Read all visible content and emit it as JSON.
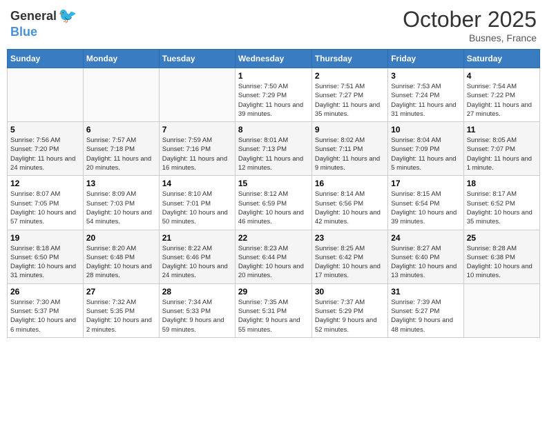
{
  "header": {
    "logo_general": "General",
    "logo_blue": "Blue",
    "month_title": "October 2025",
    "location": "Busnes, France"
  },
  "days_of_week": [
    "Sunday",
    "Monday",
    "Tuesday",
    "Wednesday",
    "Thursday",
    "Friday",
    "Saturday"
  ],
  "weeks": [
    [
      {
        "day": "",
        "info": ""
      },
      {
        "day": "",
        "info": ""
      },
      {
        "day": "",
        "info": ""
      },
      {
        "day": "1",
        "info": "Sunrise: 7:50 AM\nSunset: 7:29 PM\nDaylight: 11 hours and 39 minutes."
      },
      {
        "day": "2",
        "info": "Sunrise: 7:51 AM\nSunset: 7:27 PM\nDaylight: 11 hours and 35 minutes."
      },
      {
        "day": "3",
        "info": "Sunrise: 7:53 AM\nSunset: 7:24 PM\nDaylight: 11 hours and 31 minutes."
      },
      {
        "day": "4",
        "info": "Sunrise: 7:54 AM\nSunset: 7:22 PM\nDaylight: 11 hours and 27 minutes."
      }
    ],
    [
      {
        "day": "5",
        "info": "Sunrise: 7:56 AM\nSunset: 7:20 PM\nDaylight: 11 hours and 24 minutes."
      },
      {
        "day": "6",
        "info": "Sunrise: 7:57 AM\nSunset: 7:18 PM\nDaylight: 11 hours and 20 minutes."
      },
      {
        "day": "7",
        "info": "Sunrise: 7:59 AM\nSunset: 7:16 PM\nDaylight: 11 hours and 16 minutes."
      },
      {
        "day": "8",
        "info": "Sunrise: 8:01 AM\nSunset: 7:13 PM\nDaylight: 11 hours and 12 minutes."
      },
      {
        "day": "9",
        "info": "Sunrise: 8:02 AM\nSunset: 7:11 PM\nDaylight: 11 hours and 9 minutes."
      },
      {
        "day": "10",
        "info": "Sunrise: 8:04 AM\nSunset: 7:09 PM\nDaylight: 11 hours and 5 minutes."
      },
      {
        "day": "11",
        "info": "Sunrise: 8:05 AM\nSunset: 7:07 PM\nDaylight: 11 hours and 1 minute."
      }
    ],
    [
      {
        "day": "12",
        "info": "Sunrise: 8:07 AM\nSunset: 7:05 PM\nDaylight: 10 hours and 57 minutes."
      },
      {
        "day": "13",
        "info": "Sunrise: 8:09 AM\nSunset: 7:03 PM\nDaylight: 10 hours and 54 minutes."
      },
      {
        "day": "14",
        "info": "Sunrise: 8:10 AM\nSunset: 7:01 PM\nDaylight: 10 hours and 50 minutes."
      },
      {
        "day": "15",
        "info": "Sunrise: 8:12 AM\nSunset: 6:59 PM\nDaylight: 10 hours and 46 minutes."
      },
      {
        "day": "16",
        "info": "Sunrise: 8:14 AM\nSunset: 6:56 PM\nDaylight: 10 hours and 42 minutes."
      },
      {
        "day": "17",
        "info": "Sunrise: 8:15 AM\nSunset: 6:54 PM\nDaylight: 10 hours and 39 minutes."
      },
      {
        "day": "18",
        "info": "Sunrise: 8:17 AM\nSunset: 6:52 PM\nDaylight: 10 hours and 35 minutes."
      }
    ],
    [
      {
        "day": "19",
        "info": "Sunrise: 8:18 AM\nSunset: 6:50 PM\nDaylight: 10 hours and 31 minutes."
      },
      {
        "day": "20",
        "info": "Sunrise: 8:20 AM\nSunset: 6:48 PM\nDaylight: 10 hours and 28 minutes."
      },
      {
        "day": "21",
        "info": "Sunrise: 8:22 AM\nSunset: 6:46 PM\nDaylight: 10 hours and 24 minutes."
      },
      {
        "day": "22",
        "info": "Sunrise: 8:23 AM\nSunset: 6:44 PM\nDaylight: 10 hours and 20 minutes."
      },
      {
        "day": "23",
        "info": "Sunrise: 8:25 AM\nSunset: 6:42 PM\nDaylight: 10 hours and 17 minutes."
      },
      {
        "day": "24",
        "info": "Sunrise: 8:27 AM\nSunset: 6:40 PM\nDaylight: 10 hours and 13 minutes."
      },
      {
        "day": "25",
        "info": "Sunrise: 8:28 AM\nSunset: 6:38 PM\nDaylight: 10 hours and 10 minutes."
      }
    ],
    [
      {
        "day": "26",
        "info": "Sunrise: 7:30 AM\nSunset: 5:37 PM\nDaylight: 10 hours and 6 minutes."
      },
      {
        "day": "27",
        "info": "Sunrise: 7:32 AM\nSunset: 5:35 PM\nDaylight: 10 hours and 2 minutes."
      },
      {
        "day": "28",
        "info": "Sunrise: 7:34 AM\nSunset: 5:33 PM\nDaylight: 9 hours and 59 minutes."
      },
      {
        "day": "29",
        "info": "Sunrise: 7:35 AM\nSunset: 5:31 PM\nDaylight: 9 hours and 55 minutes."
      },
      {
        "day": "30",
        "info": "Sunrise: 7:37 AM\nSunset: 5:29 PM\nDaylight: 9 hours and 52 minutes."
      },
      {
        "day": "31",
        "info": "Sunrise: 7:39 AM\nSunset: 5:27 PM\nDaylight: 9 hours and 48 minutes."
      },
      {
        "day": "",
        "info": ""
      }
    ]
  ]
}
